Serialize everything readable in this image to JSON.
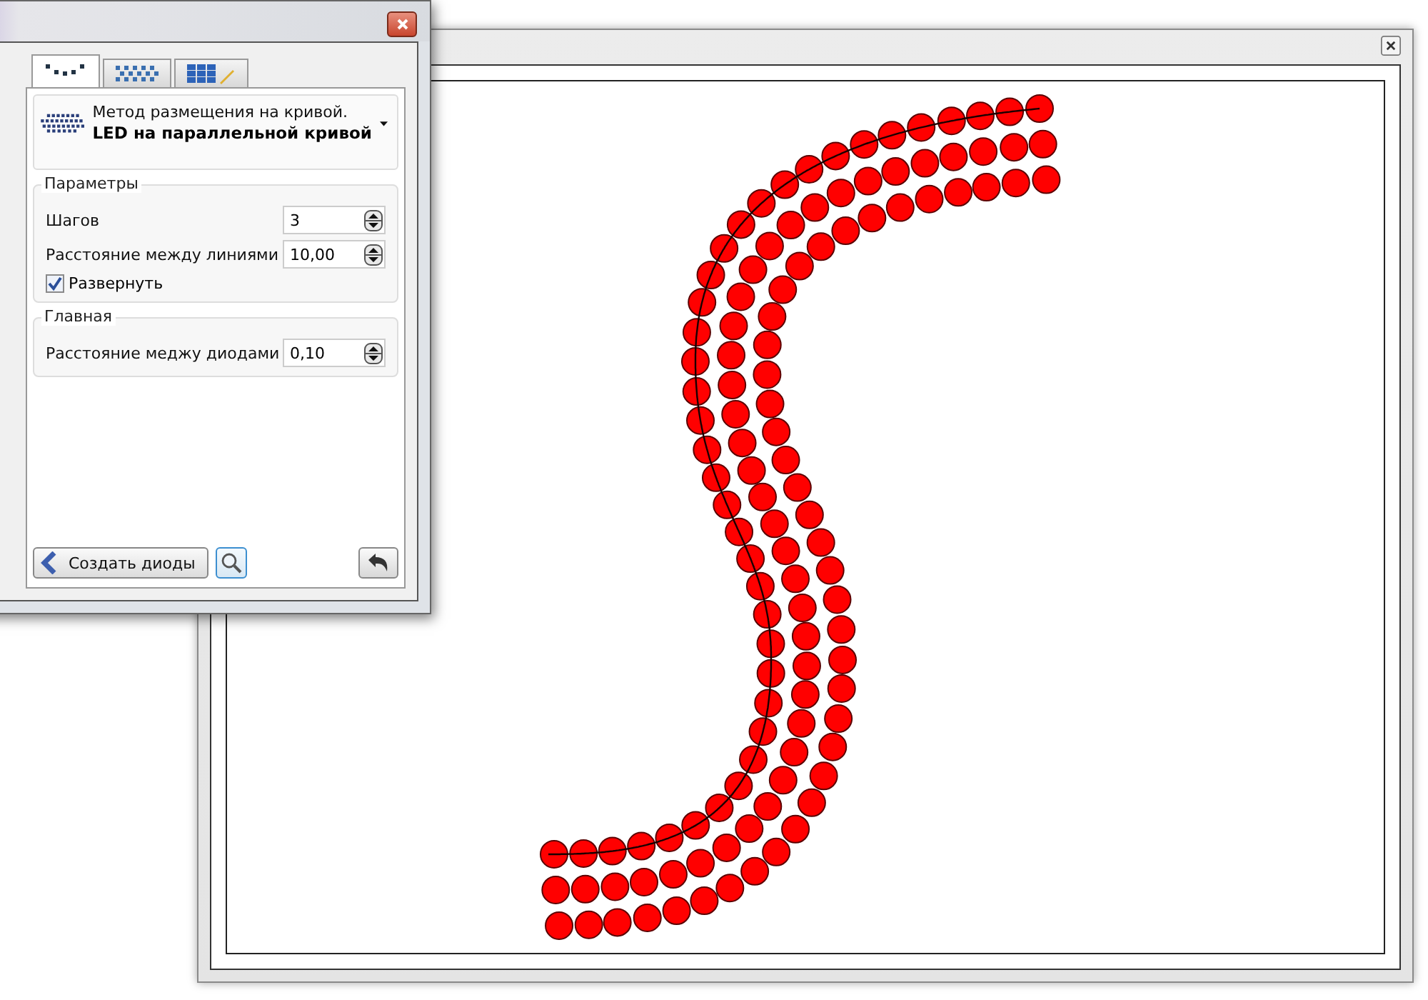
{
  "panel": {
    "tabs": [
      {
        "kind": "dots",
        "selected": true
      },
      {
        "kind": "grid",
        "selected": false
      },
      {
        "kind": "grid-pencil",
        "selected": false
      }
    ],
    "method": {
      "label": "Метод размещения на кривой.",
      "value": "LED на параллельной кривой"
    },
    "groups": [
      {
        "title": "Параметры",
        "fields": [
          {
            "label": "Шагов",
            "value": "3"
          },
          {
            "label": "Расстояние между линиями",
            "value": "10,00"
          }
        ],
        "checkbox": {
          "label": "Развернуть",
          "checked": true
        }
      },
      {
        "title": "Главная",
        "fields": [
          {
            "label": "Расстояние меджу диодами",
            "value": "0,10"
          }
        ]
      }
    ],
    "create_button": "Создать диоды"
  }
}
